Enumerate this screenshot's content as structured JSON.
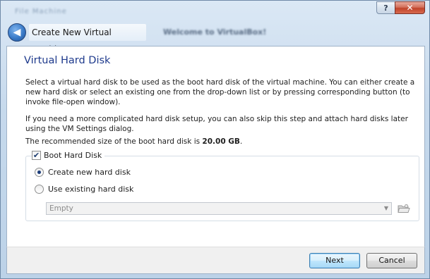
{
  "window": {
    "help_glyph": "?",
    "close_glyph": "✕",
    "blurred_title": "File   Machine",
    "blurred_background_text": "Welcome to VirtualBox!"
  },
  "header": {
    "back_glyph": "◀",
    "wizard_title": "Create New Virtual Machine"
  },
  "page": {
    "heading": "Virtual Hard Disk",
    "paragraph1": "Select a virtual hard disk to be used as the boot hard disk of the virtual machine. You can either create a new hard disk or select an existing one from the drop-down list or by pressing corresponding button (to invoke file-open window).",
    "paragraph2": "If you need a more complicated hard disk setup, you can also skip this step and attach hard disks later using the VM Settings dialog.",
    "recommended_prefix": "The recommended size of the boot hard disk is ",
    "recommended_size": "20.00 GB",
    "recommended_suffix": "."
  },
  "boot_disk": {
    "checkbox_label": "Boot Hard Disk",
    "checked": true,
    "check_glyph": "✔",
    "option_create": "Create new hard disk",
    "option_existing": "Use existing hard disk",
    "selected_option": "create",
    "combo_value": "Empty",
    "combo_arrow": "▼"
  },
  "footer": {
    "next_label": "Next",
    "cancel_label": "Cancel"
  },
  "icons": {
    "back": "back-arrow-icon",
    "folder": "open-folder-icon",
    "help": "help-icon",
    "close": "close-icon"
  }
}
